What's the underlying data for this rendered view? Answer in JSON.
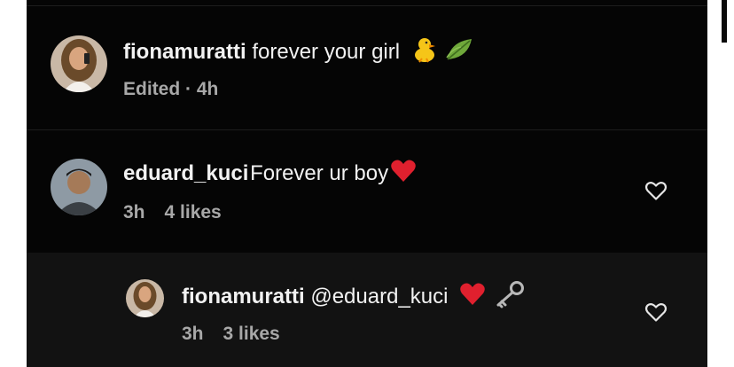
{
  "comments": [
    {
      "username": "fionamuratti",
      "text": "forever your girl",
      "emojis": [
        "chick-icon",
        "leaf-icon"
      ],
      "meta": "Edited · 4h"
    },
    {
      "username": "eduard_kuci",
      "text": "Forever ur boy",
      "emojis": [
        "red-heart-icon"
      ],
      "time": "3h",
      "likes": "4 likes"
    }
  ],
  "reply": {
    "username": "fionamuratti",
    "text": "@eduard_kuci",
    "emojis": [
      "red-heart-icon",
      "key-icon"
    ],
    "time": "3h",
    "likes": "3 likes"
  },
  "colors": {
    "background": "#050505",
    "reply_background": "#121212",
    "text": "#f2f2f2",
    "meta": "#a8a8a8",
    "heart": "#e0202e"
  }
}
